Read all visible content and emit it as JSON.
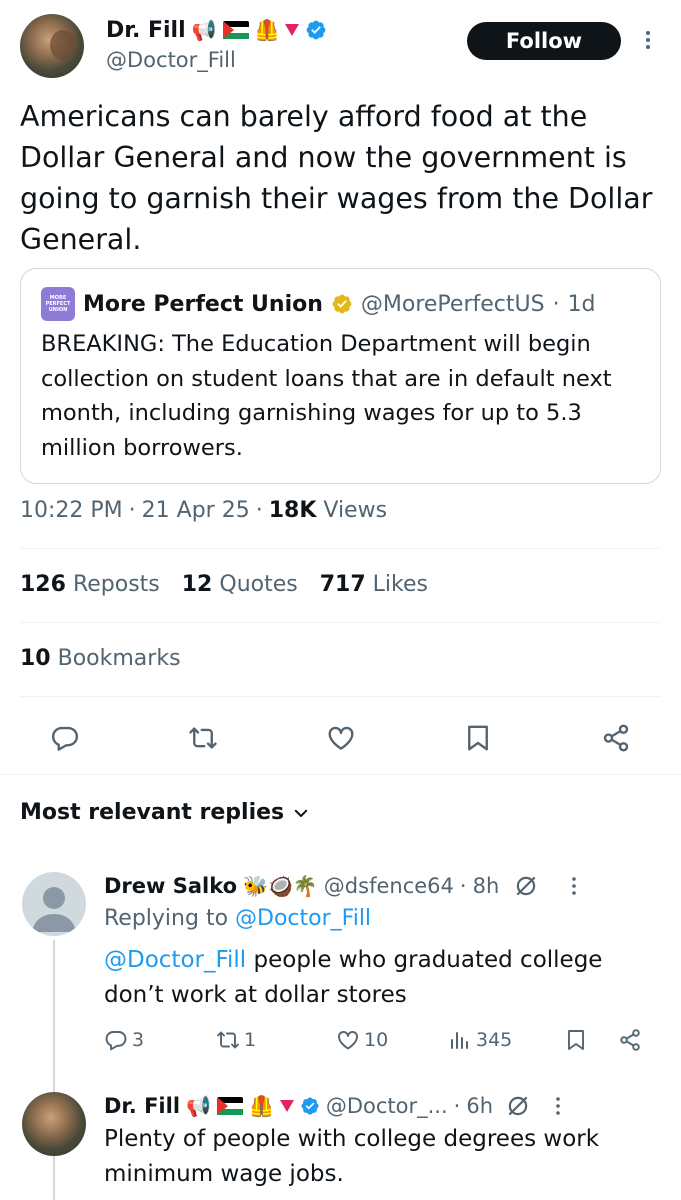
{
  "tweet": {
    "author_name": "Dr. Fill",
    "author_emoji": [
      "📢",
      "🦺",
      "🔻"
    ],
    "author_handle": "@Doctor_Fill",
    "follow_label": "Follow",
    "text": "Americans can barely afford food at the Dollar General and now the government is going to garnish their wages from the Dollar General.",
    "time": "10:22 PM",
    "date": "21 Apr 25",
    "views_count": "18K",
    "views_label": "Views"
  },
  "quote": {
    "logo_text": "MORE PERFECT UNION",
    "name": "More Perfect Union",
    "handle": "@MorePerfectUS",
    "age": "1d",
    "text": "BREAKING: The Education Department will begin collection on student loans that are in default next month, including garnishing wages for up to 5.3 million borrowers."
  },
  "stats": {
    "reposts_count": "126",
    "reposts_label": "Reposts",
    "quotes_count": "12",
    "quotes_label": "Quotes",
    "likes_count": "717",
    "likes_label": "Likes",
    "bookmarks_count": "10",
    "bookmarks_label": "Bookmarks"
  },
  "replies_header": "Most relevant replies",
  "replies": [
    {
      "name": "Drew Salko",
      "emoji": "🐝🥥🌴",
      "handle": "@dsfence64",
      "age": "8h",
      "replying_prefix": "Replying to",
      "replying_handle": "@Doctor_Fill",
      "mention": "@Doctor_Fill",
      "text": "people who graduated college don’t work at dollar stores",
      "replies_count": "3",
      "reposts_count": "1",
      "likes_count": "10",
      "views_count": "345"
    },
    {
      "name": "Dr. Fill",
      "handle": "@Doctor_...",
      "age": "6h",
      "text": "Plenty of people with college degrees work minimum wage jobs."
    }
  ],
  "colors": {
    "accent": "#1d9bf0",
    "muted": "#536471",
    "divider": "#eff3f4",
    "follow_bg": "#0f1419",
    "gold_badge": "#e2b719"
  },
  "icons": [
    "verified-badge-icon",
    "gold-verified-icon",
    "more-icon",
    "reply-icon",
    "repost-icon",
    "like-icon",
    "bookmark-icon",
    "share-icon",
    "views-icon",
    "grok-icon",
    "chevron-down-icon"
  ]
}
